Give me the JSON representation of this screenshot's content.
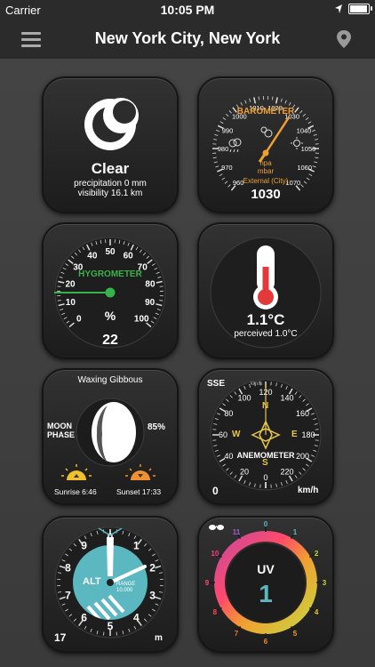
{
  "status": {
    "carrier": "Carrier",
    "time": "10:05 PM"
  },
  "header": {
    "title": "New York City, New York"
  },
  "weather": {
    "condition": "Clear",
    "precipitation": "precipitation  0 mm",
    "visibility": "visibility 16.1 km"
  },
  "barometer": {
    "label": "BAROMETER",
    "unit1": "hpa",
    "unit2": "mbar",
    "source": "External (City)",
    "value": "1030",
    "ticks": [
      "960",
      "970",
      "980",
      "990",
      "1000",
      "1010",
      "1020",
      "1030",
      "1040",
      "1050",
      "1060",
      "1070"
    ]
  },
  "hygrometer": {
    "label": "HYGROMETER",
    "unit": "%",
    "value": "22",
    "ticks": [
      "0",
      "10",
      "20",
      "30",
      "40",
      "50",
      "60",
      "70",
      "80",
      "90",
      "100"
    ]
  },
  "thermometer": {
    "value": "1.1°C",
    "perceived": "perceived 1.0°C"
  },
  "moon": {
    "phase_name": "Waxing Gibbous",
    "label1": "MOON",
    "label2": "PHASE",
    "illumination": "85%",
    "sunrise": "Sunrise 6:46",
    "sunset": "Sunset 17:33"
  },
  "anemometer": {
    "direction": "SSE",
    "unit_top": "km/h",
    "label": "ANEMOMETER",
    "speed": "0",
    "unit": "km/h",
    "ticks": [
      "0",
      "20",
      "40",
      "60",
      "80",
      "100",
      "120",
      "140",
      "160",
      "180",
      "200",
      "220"
    ],
    "compass": {
      "n": "N",
      "s": "S",
      "e": "E",
      "w": "W"
    }
  },
  "altimeter": {
    "label": "ALT",
    "range_label": "RANGE",
    "range_value": "10.000",
    "value": "17",
    "unit": "m",
    "ticks": [
      "0",
      "1",
      "2",
      "3",
      "4",
      "5",
      "6",
      "7",
      "8",
      "9"
    ]
  },
  "uv": {
    "label": "UV",
    "value": "1",
    "ticks": [
      "0",
      "1",
      "2",
      "3",
      "4",
      "5",
      "6",
      "7",
      "8",
      "9",
      "10",
      "11"
    ]
  },
  "colors": {
    "accent_orange": "#f0a030",
    "hygro_green": "#38b24a",
    "thermo_red": "#e23a3a",
    "alt_teal": "#5bb8c0"
  }
}
